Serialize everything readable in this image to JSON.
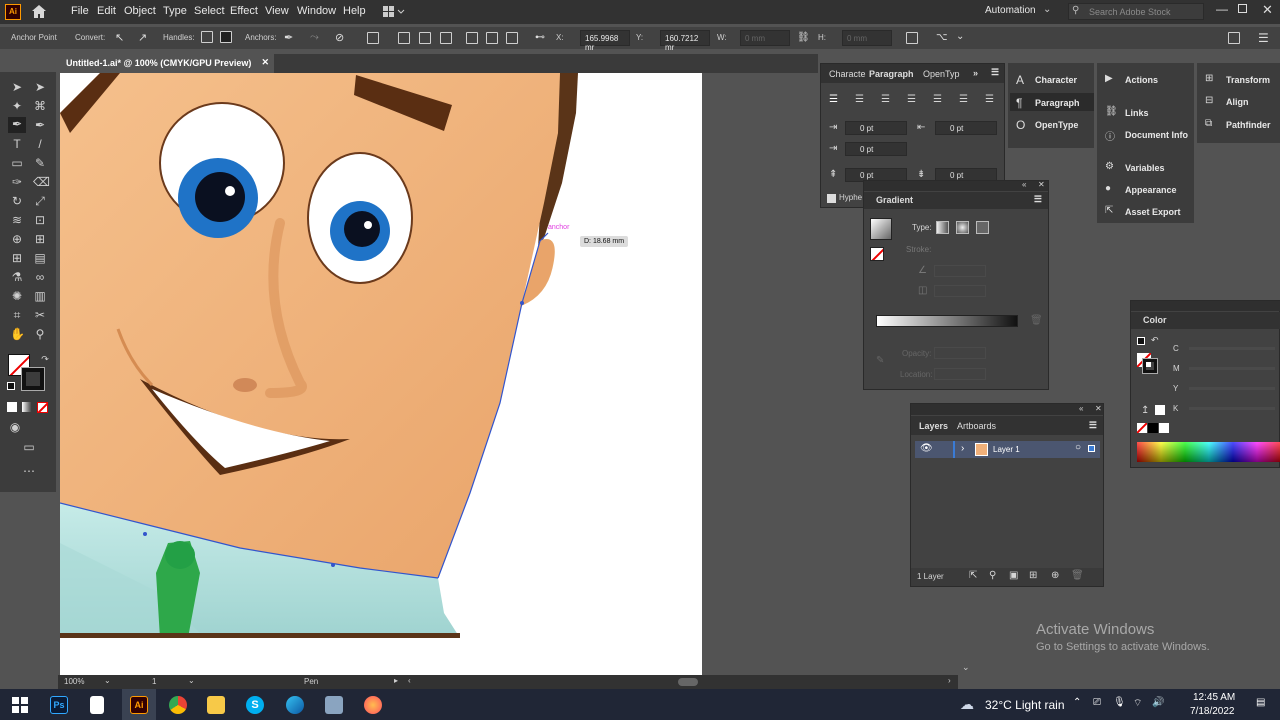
{
  "app": {
    "logo_text": "Ai",
    "window_title": "Untitled-1.ai* @ 100% (CMYK/GPU Preview)"
  },
  "menu": [
    "File",
    "Edit",
    "Object",
    "Type",
    "Select",
    "Effect",
    "View",
    "Window",
    "Help"
  ],
  "workspace": "Automation",
  "search_placeholder": "Search Adobe Stock",
  "control": {
    "anchor_point": "Anchor Point",
    "convert": "Convert:",
    "handles": "Handles:",
    "anchors": "Anchors:",
    "x_label": "X:",
    "x_value": "165.9968 mr",
    "y_label": "Y:",
    "y_value": "160.7212 mr",
    "w_label": "W:",
    "w_value": "0 mm",
    "h_label": "H:",
    "h_value": "0 mm"
  },
  "canvas": {
    "anchor_hint": "anchor",
    "tooltip": "D: 18.68 mm"
  },
  "status": {
    "zoom": "100%",
    "page": "1",
    "tool": "Pen"
  },
  "paragraph_panel": {
    "tabs": [
      "Characte",
      "Paragraph",
      "OpenTyp"
    ],
    "fields": [
      "0 pt",
      "0 pt",
      "0 pt",
      "0 pt",
      "0 pt"
    ],
    "hyphenate": "Hyphe"
  },
  "gradient_panel": {
    "title": "Gradient",
    "type_label": "Type:",
    "stroke_label": "Stroke:",
    "opacity_label": "Opacity:",
    "location_label": "Location:"
  },
  "layers_panel": {
    "tabs": [
      "Layers",
      "Artboards"
    ],
    "layer_name": "Layer 1",
    "count": "1 Layer"
  },
  "color_panel": {
    "title": "Color",
    "channels": [
      "C",
      "M",
      "Y",
      "K"
    ]
  },
  "dock": {
    "col1": [
      "Character",
      "Paragraph",
      "OpenType"
    ],
    "col2": [
      "Actions",
      "Links",
      "Document Info",
      "Variables",
      "Appearance",
      "Asset Export"
    ],
    "col3": [
      "Transform",
      "Align",
      "Pathfinder"
    ]
  },
  "watermark": {
    "line1": "Activate Windows",
    "line2": "Go to Settings to activate Windows."
  },
  "taskbar": {
    "weather": "32°C  Light rain",
    "time": "12:45 AM",
    "date": "7/18/2022"
  }
}
